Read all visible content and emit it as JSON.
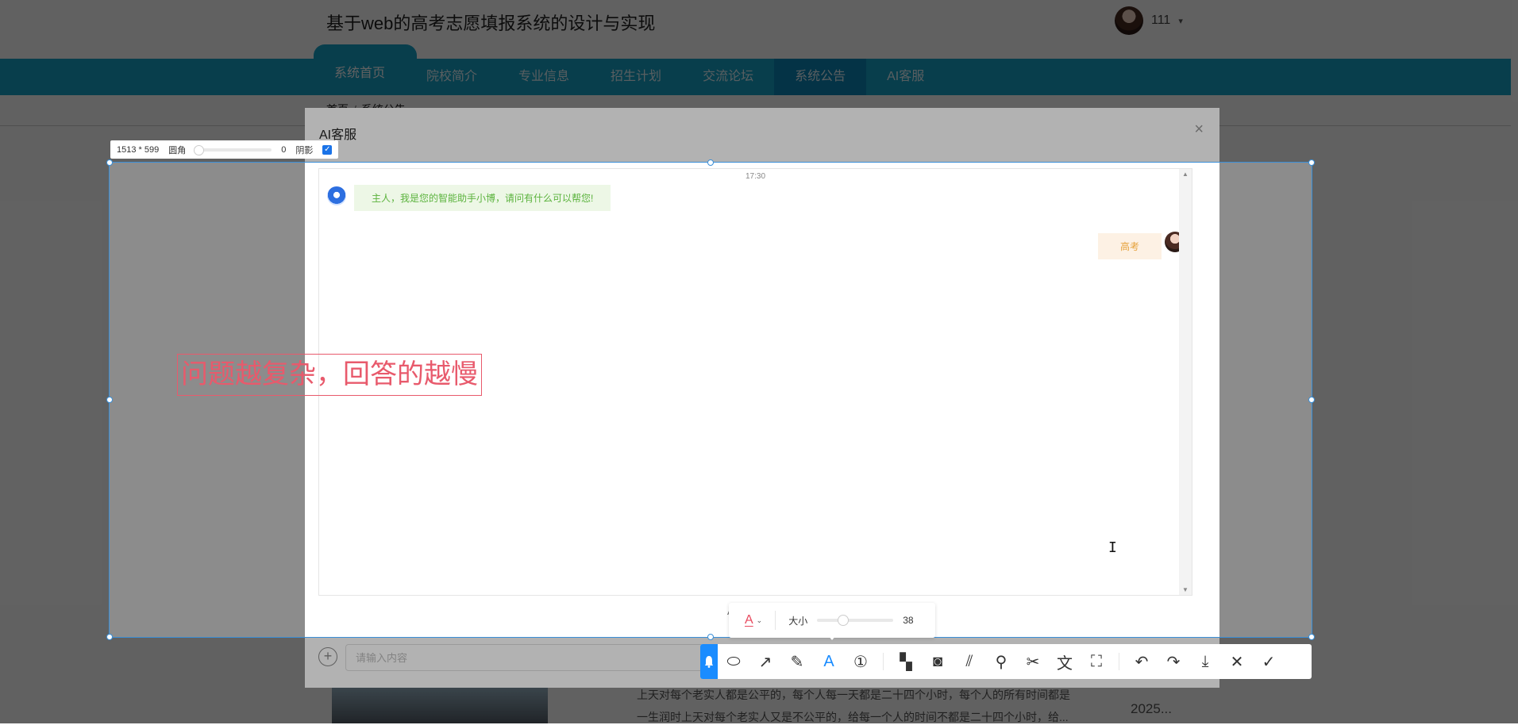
{
  "site": {
    "title": "基于web的高考志愿填报系统的设计与实现",
    "user_name": "111",
    "caret": "▾"
  },
  "nav": {
    "items": [
      "系统首页",
      "院校简介",
      "专业信息",
      "招生计划",
      "交流论坛",
      "系统公告",
      "AI客服"
    ],
    "active": "系统公告"
  },
  "breadcrumb": {
    "home": "首页",
    "current": "系统公告"
  },
  "background": {
    "text_line1": "上天对每个老实人都是公平的，每个人每一天都是二十四个小时，每个人的所有时间都是",
    "text_line2": "一生润时上天对每个老实人又是不公平的，给每一个人的时间不都是二十四个小时，给...",
    "year": "2025..."
  },
  "dialog": {
    "title": "AI客服",
    "close": "×",
    "time": "17:30",
    "bot_message": "主人，我是您的智能助手小博，请问有什么可以帮您!",
    "user_message": "高考",
    "status": "AI正在思考中...",
    "input_placeholder": "请输入内容",
    "add_icon": "+"
  },
  "capture": {
    "dimensions": "1513 * 599",
    "radius_label": "圆角",
    "radius_value": "0",
    "shadow_label": "阴影",
    "shadow_checked": true,
    "annotation_text": "问题越复杂，回答的越慢",
    "font_color_glyph": "A",
    "size_label": "大小",
    "size_value": "38",
    "accent": "#1a8cff",
    "annotation_color": "#e85a6c"
  },
  "toolbar": {
    "tools": [
      {
        "name": "shape-tool",
        "glyph": "⬭"
      },
      {
        "name": "arrow-tool",
        "glyph": "↗"
      },
      {
        "name": "pen-tool",
        "glyph": "✎"
      },
      {
        "name": "text-tool",
        "glyph": "A"
      },
      {
        "name": "number-tool",
        "glyph": "①"
      }
    ],
    "tools2": [
      {
        "name": "mosaic-tool",
        "glyph": "▚"
      },
      {
        "name": "blur-tool",
        "glyph": "◙"
      },
      {
        "name": "stroke-tool",
        "glyph": "⫽"
      },
      {
        "name": "pin-tool",
        "glyph": "⚲"
      },
      {
        "name": "cut-tool",
        "glyph": "✂"
      },
      {
        "name": "translate-tool",
        "glyph": "文"
      },
      {
        "name": "ocr-tool",
        "glyph": "⛶"
      }
    ],
    "actions": [
      {
        "name": "undo-button",
        "glyph": "↶"
      },
      {
        "name": "redo-button",
        "glyph": "↷"
      },
      {
        "name": "download-button",
        "glyph": "⤓"
      },
      {
        "name": "cancel-button",
        "glyph": "✕"
      },
      {
        "name": "confirm-button",
        "glyph": "✓"
      }
    ]
  }
}
